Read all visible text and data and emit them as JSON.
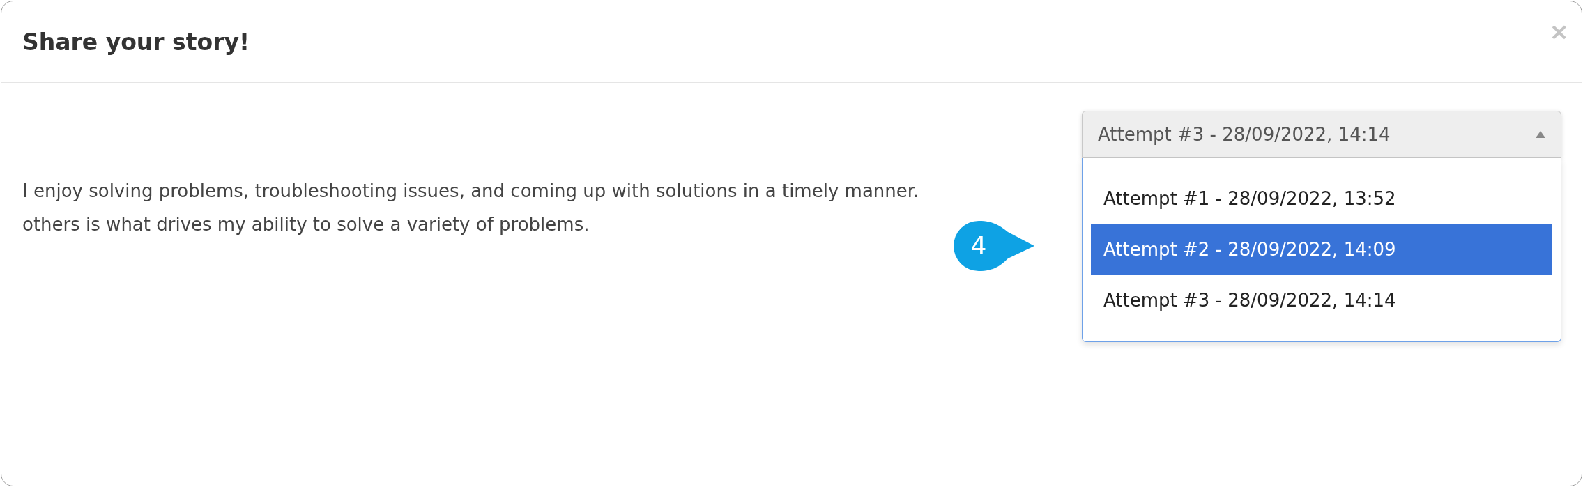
{
  "dialog": {
    "title": "Share your story!",
    "close": "×"
  },
  "story": {
    "lines": [
      "I enjoy solving problems, troubleshooting issues, and coming up with solutions in a timely manner.",
      "others is what drives my ability to solve a variety of problems."
    ]
  },
  "dropdown": {
    "value": "Attempt #3 - 28/09/2022, 14:14",
    "expanded": true,
    "options": [
      {
        "label": "Attempt #1 - 28/09/2022, 13:52",
        "highlighted": false
      },
      {
        "label": "Attempt #2 - 28/09/2022, 14:09",
        "highlighted": true
      },
      {
        "label": "Attempt #3 - 28/09/2022, 14:14",
        "highlighted": false
      }
    ]
  },
  "callout": {
    "label": "4"
  }
}
